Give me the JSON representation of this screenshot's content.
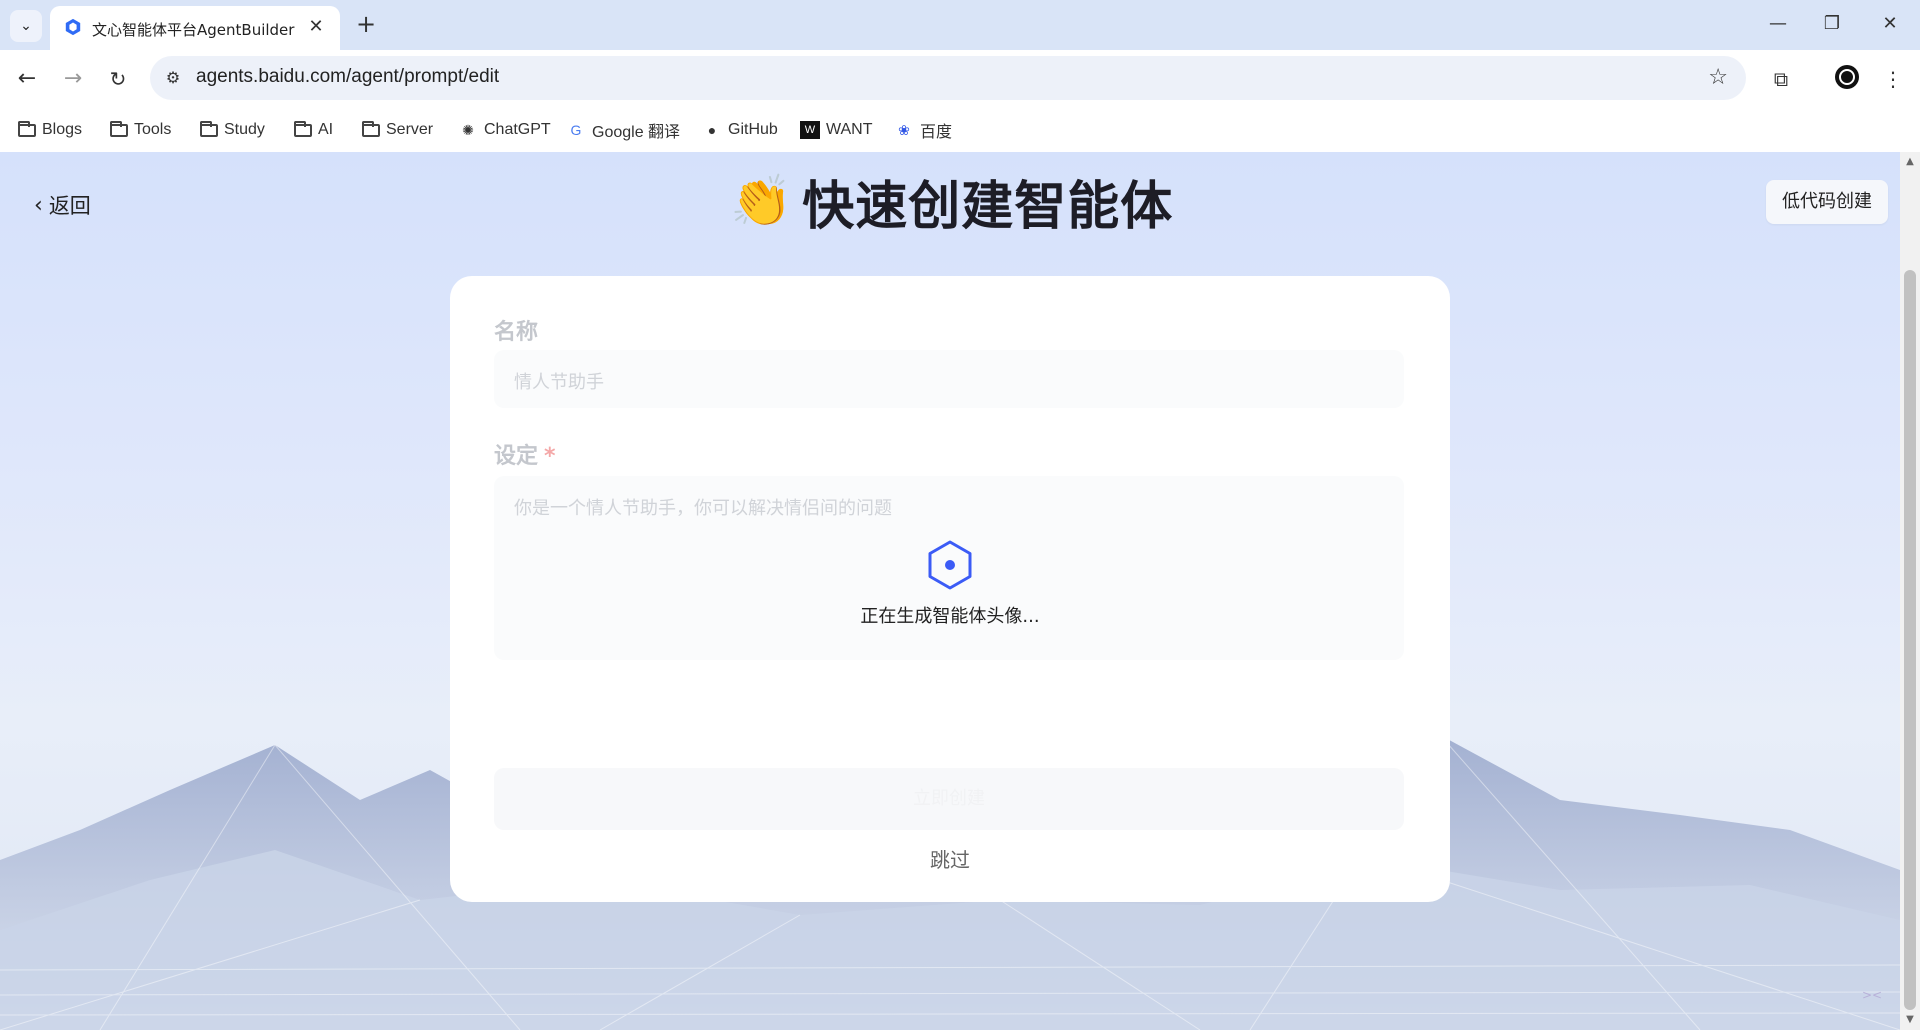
{
  "browser": {
    "tab_title": "文心智能体平台AgentBuilder",
    "url": "agents.baidu.com/agent/prompt/edit",
    "bookmarks": [
      {
        "label": "Blogs",
        "icon": "folder-icon"
      },
      {
        "label": "Tools",
        "icon": "folder-icon"
      },
      {
        "label": "Study",
        "icon": "folder-icon"
      },
      {
        "label": "AI",
        "icon": "folder-icon"
      },
      {
        "label": "Server",
        "icon": "folder-icon"
      },
      {
        "label": "ChatGPT",
        "icon": "chatgpt-icon"
      },
      {
        "label": "Google 翻译",
        "icon": "google-translate-icon"
      },
      {
        "label": "GitHub",
        "icon": "github-icon"
      },
      {
        "label": "WANT",
        "icon": "want-icon"
      },
      {
        "label": "百度",
        "icon": "baidu-paw-icon"
      }
    ]
  },
  "page": {
    "back_label": "返回",
    "title": "快速创建智能体",
    "title_emoji": "👏",
    "lowcode_label": "低代码创建"
  },
  "form": {
    "name_label": "名称",
    "name_placeholder": "情人节助手",
    "setting_label": "设定",
    "required_mark": "*",
    "setting_placeholder": "你是一个情人节助手，你可以解决情侣间的问题",
    "submit_label": "立即创建",
    "skip_label": "跳过"
  },
  "loading": {
    "text": "正在生成智能体头像..."
  },
  "colors": {
    "accent": "#3b5bf6",
    "page_bg": "#dae4fb"
  }
}
